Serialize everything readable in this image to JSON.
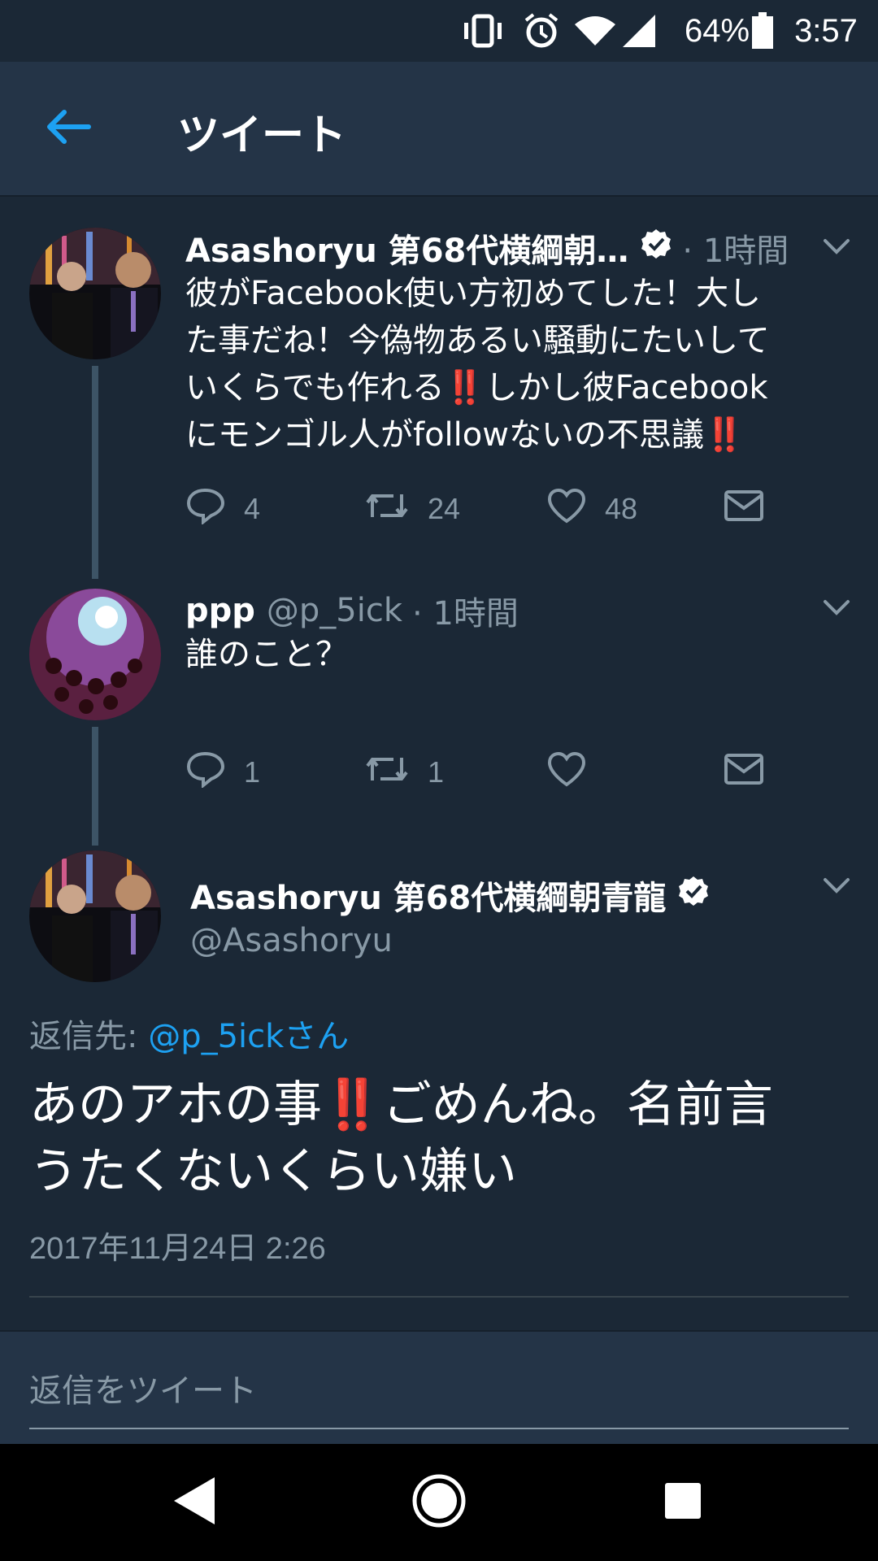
{
  "status_bar": {
    "battery": "64%",
    "time": "3:57",
    "icons": [
      "vibrate-icon",
      "alarm-icon",
      "wifi-icon",
      "signal-icon",
      "battery-icon"
    ]
  },
  "header": {
    "title": "ツイート",
    "back_icon": "arrow-left-icon"
  },
  "colors": {
    "background": "#1b2836",
    "header_bg": "#243447",
    "accent": "#1da1f2",
    "muted": "#8899a6",
    "thread_line": "#3d5466"
  },
  "tweets": [
    {
      "name": "Asashoryu 第68代横綱朝…",
      "verified": true,
      "meta": "· 1時間",
      "lines": [
        "彼がFacebook使い方初めてした！大し",
        "た事だね！今偽物あるい騒動にたいして",
        "いくらでも作れる‼️しかし彼Facebook",
        "にモンゴル人がfollowないの不思議‼️"
      ],
      "reply_count": "4",
      "retweet_count": "24",
      "like_count": "48"
    },
    {
      "name": "ppp",
      "handle": "@p_5ick",
      "meta": "· 1時間",
      "text": "誰のこと？",
      "reply_count": "1",
      "retweet_count": "1",
      "like_count": ""
    }
  ],
  "main_tweet": {
    "name": "Asashoryu 第68代横綱朝青龍",
    "handle": "@Asashoryu",
    "verified": true,
    "reply_to_label": "返信先: ",
    "reply_to_user": "@p_5ickさん",
    "lines": [
      "あのアホの事‼️ごめんね。名前言",
      "うたくないくらい嫌い"
    ],
    "timestamp": "2017年11月24日 2:26"
  },
  "reply_bar": {
    "placeholder": "返信をツイート"
  },
  "nav": {
    "icons": [
      "back-triangle-icon",
      "home-circle-icon",
      "recents-square-icon"
    ]
  }
}
